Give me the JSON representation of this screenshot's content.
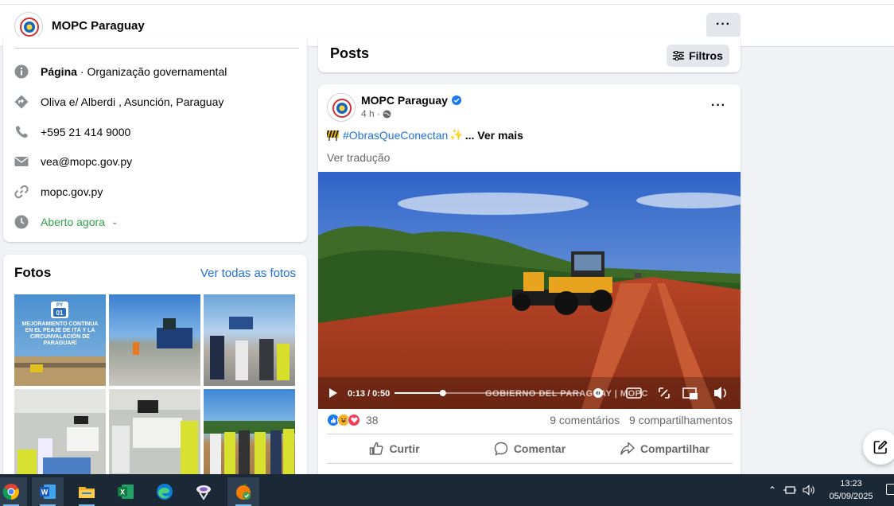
{
  "header": {
    "page_name": "MOPC Paraguay",
    "more": "···"
  },
  "intro": {
    "category_bold": "Página",
    "category_rest": "· Organização governamental",
    "address": "Oliva e/ Alberdi , Asunción, Paraguay",
    "phone": "+595 21 414 9000",
    "email": "vea@mopc.gov.py",
    "website": "mopc.gov.py",
    "hours": "Aberto agora"
  },
  "photos": {
    "title": "Fotos",
    "see_all": "Ver todas as fotos",
    "first_caption_badge_top": "PY",
    "first_caption_badge": "01",
    "first_caption": "MEJORAMIENTO CONTINUA EN EL PEAJE DE ITÁ Y LA CIRCUNVALACIÓN DE PARAGUARÍ"
  },
  "posts": {
    "title": "Posts",
    "filters_label": "Filtros"
  },
  "post": {
    "author": "MOPC Paraguay",
    "time": "4 h",
    "time_sep": "·",
    "hashtag": "#ObrasQueConectan",
    "see_more": "... Ver mais",
    "translate": "Ver tradução",
    "video_time": "0:13 / 0:50",
    "video_progress": 0.26,
    "watermark": "GOBIERNO DEL PARAGUAY | MOPC",
    "reaction_count": "38",
    "comments": "9 comentários",
    "shares": "9 compartilhamentos",
    "like_label": "Curtir",
    "comment_label": "Comentar",
    "share_label": "Compartilhar"
  },
  "taskbar": {
    "apps": [
      "chrome-icon",
      "word-icon",
      "file-explorer-icon",
      "excel-icon",
      "edge-icon",
      "snipping-tool-icon",
      "fruit-app-icon"
    ],
    "time": "13:23",
    "date": "05/09/2025"
  },
  "colors": {
    "link": "#216fdb",
    "green": "#31a24c",
    "taskbar": "#1b2937"
  }
}
